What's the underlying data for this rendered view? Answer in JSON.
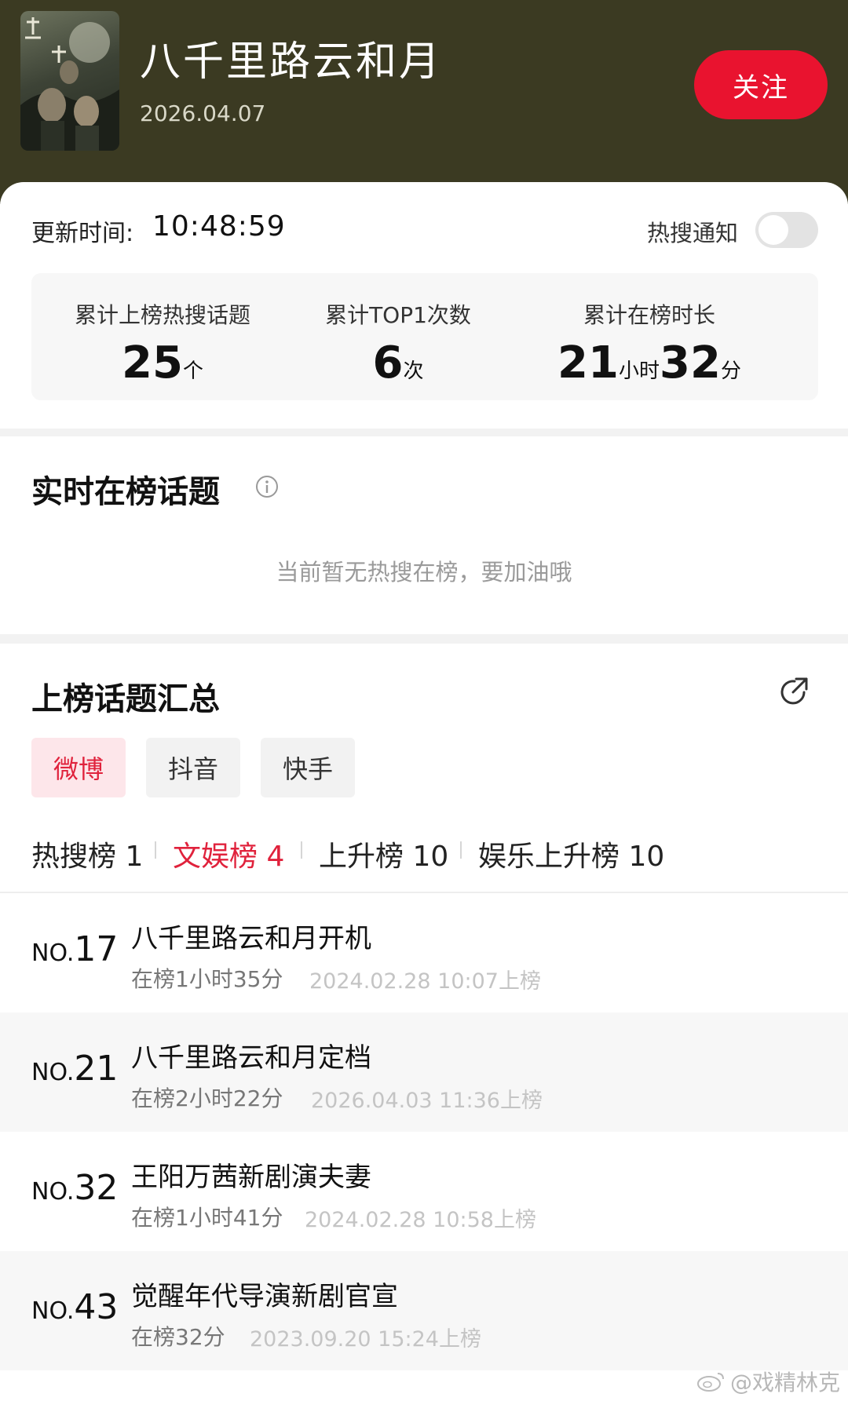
{
  "header": {
    "title": "八千里路云和月",
    "date": "2026.04.07",
    "follow_label": "关注"
  },
  "update": {
    "label": "更新时间:",
    "time": "10:48:59",
    "notify_label": "热搜通知",
    "notify_on": false
  },
  "stats": {
    "topics": {
      "label": "累计上榜热搜话题",
      "value": "25",
      "unit": "个"
    },
    "top1": {
      "label": "累计TOP1次数",
      "value": "6",
      "unit": "次"
    },
    "duration": {
      "label": "累计在榜时长",
      "hours": "21",
      "hours_unit": "小时",
      "minutes": "32",
      "minutes_unit": "分"
    }
  },
  "realtime": {
    "title": "实时在榜话题",
    "empty_text": "当前暂无热搜在榜，要加油哦"
  },
  "summary": {
    "title": "上榜话题汇总",
    "platforms": [
      {
        "label": "微博",
        "active": true
      },
      {
        "label": "抖音",
        "active": false
      },
      {
        "label": "快手",
        "active": false
      }
    ],
    "boards": [
      {
        "label": "热搜榜 1",
        "active": false
      },
      {
        "label": "文娱榜 4",
        "active": true
      },
      {
        "label": "上升榜 10",
        "active": false
      },
      {
        "label": "娱乐上升榜 10",
        "active": false
      }
    ],
    "rows": [
      {
        "no": "NO.",
        "rank": "17",
        "title": "八千里路云和月开机",
        "duration": "在榜1小时35分",
        "time": "2024.02.28 10:07上榜"
      },
      {
        "no": "NO.",
        "rank": "21",
        "title": "八千里路云和月定档",
        "duration": "在榜2小时22分",
        "time": "2026.04.03 11:36上榜"
      },
      {
        "no": "NO.",
        "rank": "32",
        "title": "王阳万茜新剧演夫妻",
        "duration": "在榜1小时41分",
        "time": "2024.02.28 10:58上榜"
      },
      {
        "no": "NO.",
        "rank": "43",
        "title": "觉醒年代导演新剧官宣",
        "duration": "在榜32分",
        "time": "2023.09.20 15:24上榜"
      }
    ]
  },
  "watermark": "@戏精林克",
  "colors": {
    "header_bg": "#3b3a22",
    "accent": "#e9132f",
    "active_tab_bg": "#fde6ea"
  },
  "icons": [
    "info-icon",
    "share-icon",
    "weibo-logo-icon"
  ]
}
